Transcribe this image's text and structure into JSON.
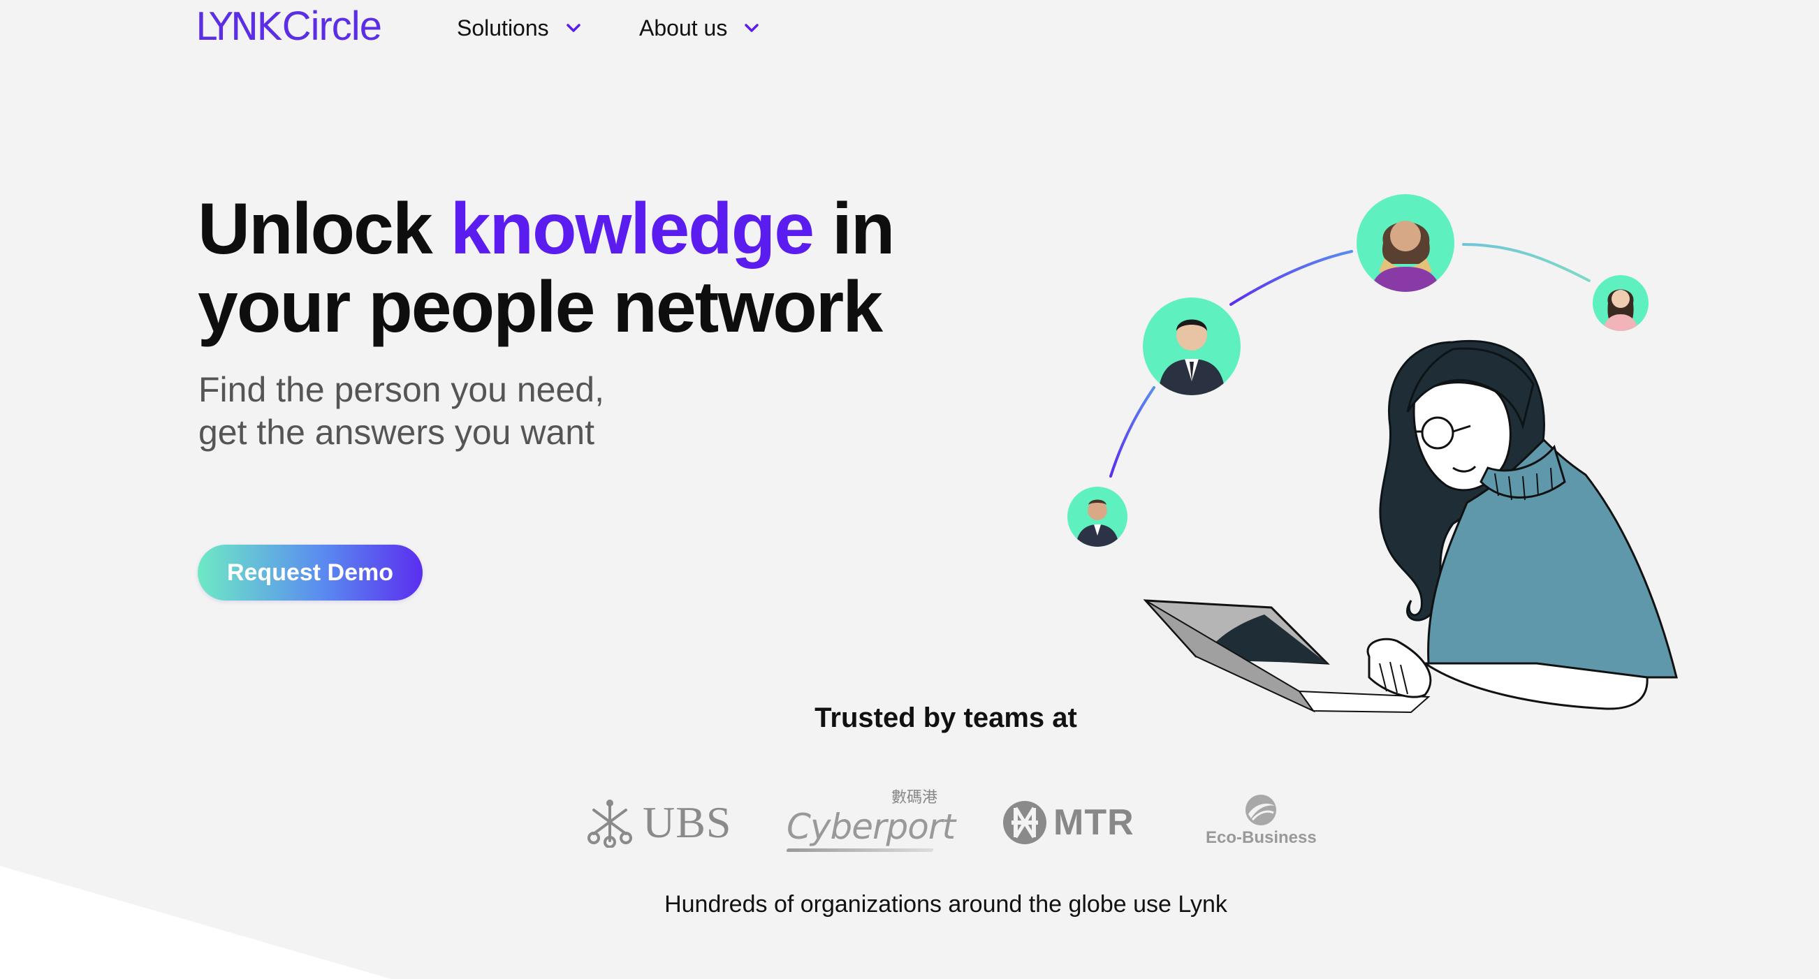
{
  "brand": {
    "logo_mark": "LYNK",
    "logo_word": "Circle",
    "accent_color": "#5b1cf0",
    "cta_gradient": [
      "#6ee9c4",
      "#5a8cf0",
      "#5b2ef0"
    ],
    "avatar_color": "#5ff0bf"
  },
  "nav": {
    "items": [
      {
        "label": "Solutions",
        "icon": "chevron-down-icon"
      },
      {
        "label": "About us",
        "icon": "chevron-down-icon"
      }
    ]
  },
  "hero": {
    "title_part1": "Unlock ",
    "title_accent": "knowledge",
    "title_part2": " in",
    "title_line2": "your people network",
    "subtitle_line1": "Find the person you need,",
    "subtitle_line2": "get the answers you want",
    "cta_label": "Request Demo"
  },
  "trust": {
    "title": "Trusted by teams at",
    "logos": [
      {
        "name": "UBS",
        "icon": "ubs-keys-icon"
      },
      {
        "name": "Cyberport",
        "cn": "數碼港"
      },
      {
        "name": "MTR",
        "icon": "mtr-icon"
      },
      {
        "name": "Eco-Business",
        "icon": "eco-business-icon"
      }
    ],
    "footer_line": "Hundreds of organizations around the globe use Lynk"
  }
}
